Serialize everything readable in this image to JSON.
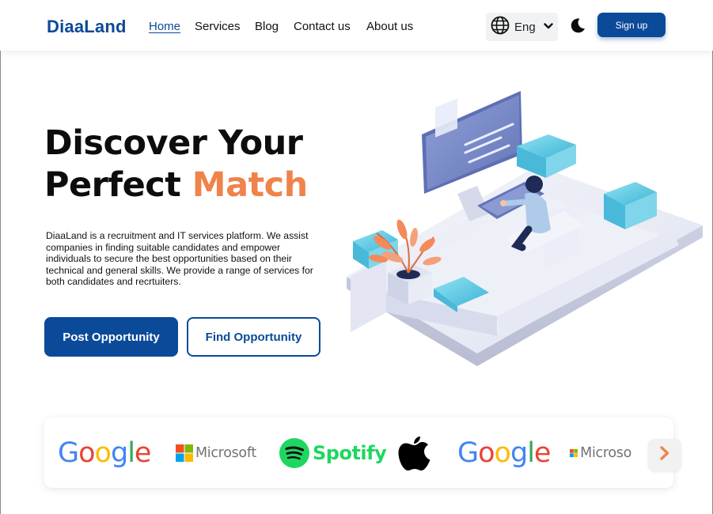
{
  "header": {
    "brand": "DiaaLand",
    "nav": [
      "Home",
      "Services",
      "Blog",
      "Contact us",
      "About us"
    ],
    "active_nav": "Home",
    "language": "Eng",
    "signup_label": "Sign up"
  },
  "hero": {
    "title_line1": "Discover Your",
    "title_line2_plain": "Perfect ",
    "title_line2_accent": "Match",
    "description": "DiaaLand is a recruitment and IT services platform. We assist companies in finding suitable candidates and empower individuals to secure the best opportunities based on their technical and general skills. We provide a range of services for both candidates and recrtuiters.",
    "primary_cta": "Post Opportunity",
    "secondary_cta": "Find Opportunity"
  },
  "partners": {
    "items": [
      "Google",
      "Microsoft",
      "Spotify",
      "Apple",
      "Google",
      "Microsoft"
    ],
    "google_word": {
      "G": "G",
      "o1": "o",
      "o2": "o",
      "g": "g",
      "l": "l",
      "e": "e"
    },
    "microsoft_label": "Microsoft",
    "microsoft_label_cut": "Microso",
    "spotify_label": "Spotify"
  },
  "colors": {
    "brand_blue": "#0b4a99",
    "accent_orange": "#f0834a",
    "spotify_green": "#1ed760",
    "google_blue": "#4285F4",
    "google_red": "#EA4335",
    "google_yellow": "#FBBC05",
    "google_green": "#34A853"
  },
  "icons": {
    "language": "globe-icon",
    "dropdown": "chevron-down-icon",
    "theme": "moon-icon",
    "carousel_next": "chevron-right-icon"
  }
}
